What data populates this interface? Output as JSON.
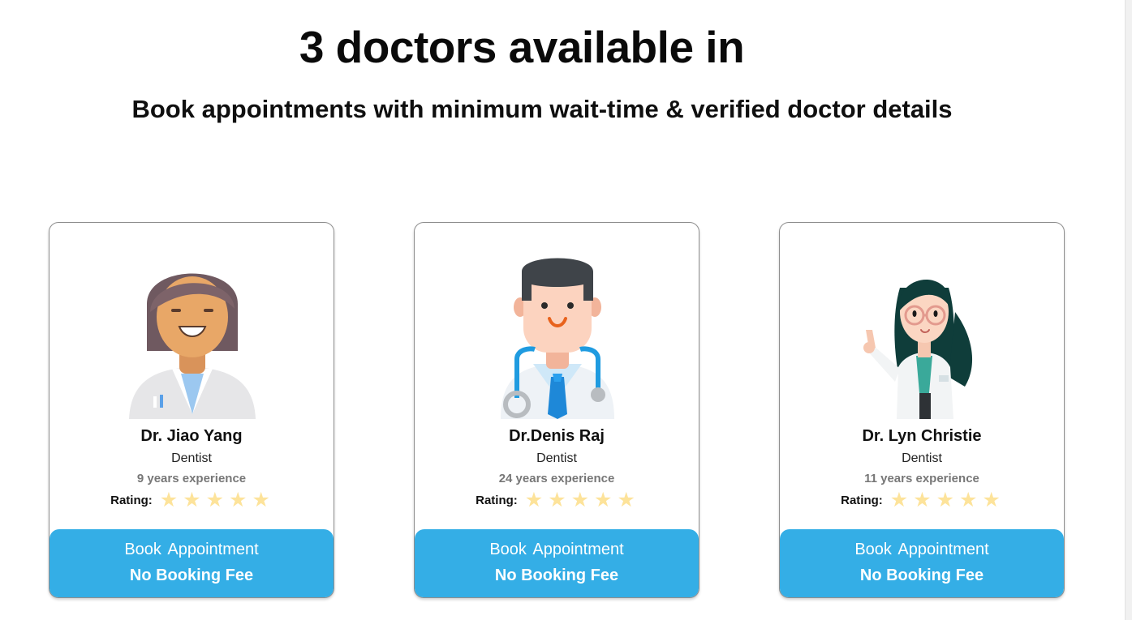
{
  "header": {
    "title": "3 doctors available in",
    "subtitle": "Book appointments with minimum wait-time & verified doctor details"
  },
  "doctors": [
    {
      "name": "Dr. Jiao Yang",
      "specialty": "Dentist",
      "experience": "9 years experience",
      "rating_label": "Rating:",
      "stars": 5,
      "avatar_icon": "female-doctor-avatar-icon",
      "book_label": "Book  Appointment",
      "fee_label": "No Booking Fee"
    },
    {
      "name": "Dr.Denis Raj",
      "specialty": "Dentist",
      "experience": "24 years experience",
      "rating_label": "Rating:",
      "stars": 5,
      "avatar_icon": "male-doctor-stethoscope-avatar-icon",
      "book_label": "Book  Appointment",
      "fee_label": "No Booking Fee"
    },
    {
      "name": "Dr. Lyn Christie",
      "specialty": "Dentist",
      "experience": "11 years experience",
      "rating_label": "Rating:",
      "stars": 5,
      "avatar_icon": "female-doctor-glasses-avatar-icon",
      "book_label": "Book  Appointment",
      "fee_label": "No Booking Fee"
    }
  ],
  "colors": {
    "button": "#34aee6",
    "star": "#fde39a",
    "experience_text": "#777777"
  }
}
